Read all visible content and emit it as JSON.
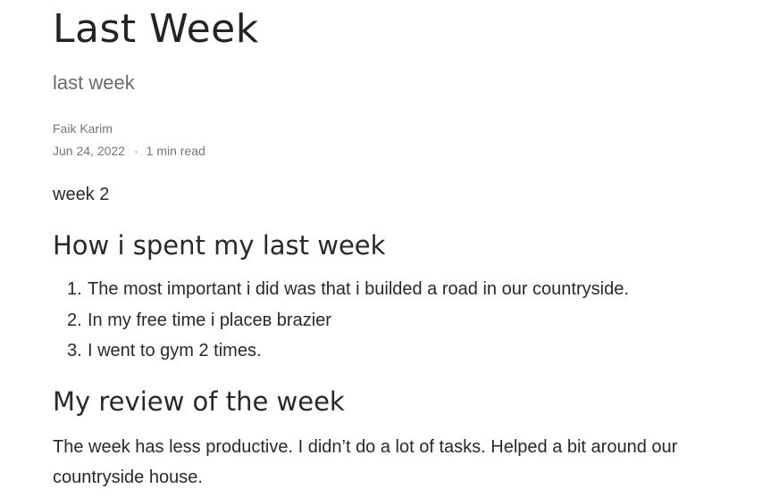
{
  "post": {
    "title": "Last Week",
    "subtitle": "last week",
    "author": "Faik Karim",
    "date": "Jun 24, 2022",
    "separator": "·",
    "read_time": "1 min read",
    "lead": "week 2"
  },
  "section_spent": {
    "heading": "How i spent my last week",
    "items": [
      {
        "number": "1.",
        "text": "The most important i did was that i builded a road in our countryside."
      },
      {
        "number": "2.",
        "text": "In my free time i placeв brazier"
      },
      {
        "number": "3.",
        "text": "I went to gym 2 times."
      }
    ]
  },
  "section_review": {
    "heading": "My review of the week",
    "text": "The week has less productive. I didn’t do a lot of tasks. Helped a bit around our countryside house."
  }
}
